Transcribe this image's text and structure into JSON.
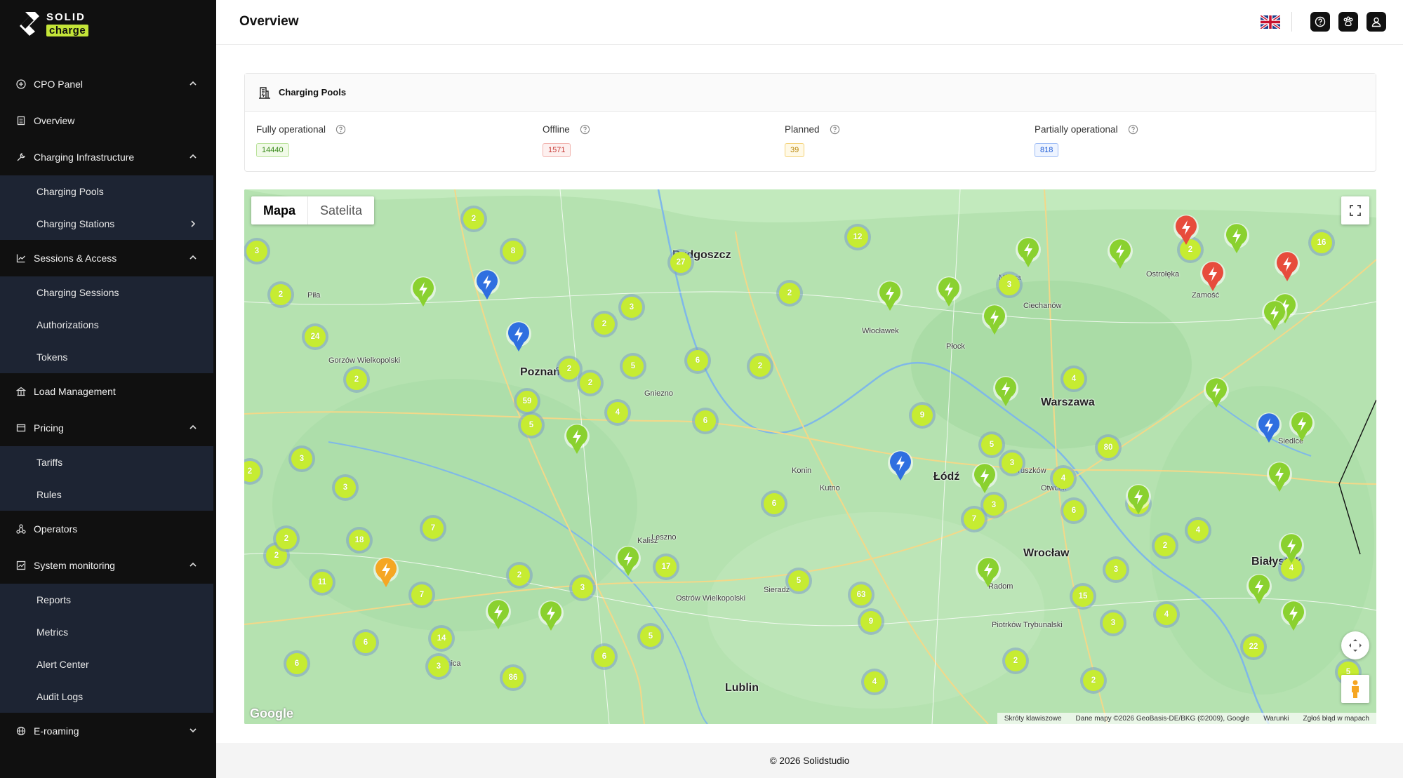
{
  "brand": {
    "line1": "SOLID",
    "line2": "charge"
  },
  "header": {
    "title": "Overview"
  },
  "nav": {
    "cpo_panel": "CPO Panel",
    "overview": "Overview",
    "charging_infrastructure": "Charging Infrastructure",
    "charging_pools": "Charging Pools",
    "charging_stations": "Charging Stations",
    "sessions_access": "Sessions & Access",
    "charging_sessions": "Charging Sessions",
    "authorizations": "Authorizations",
    "tokens": "Tokens",
    "load_management": "Load Management",
    "pricing": "Pricing",
    "tariffs": "Tariffs",
    "rules": "Rules",
    "operators": "Operators",
    "system_monitoring": "System monitoring",
    "reports": "Reports",
    "metrics": "Metrics",
    "alert_center": "Alert Center",
    "audit_logs": "Audit Logs",
    "e_roaming": "E-roaming"
  },
  "card": {
    "title": "Charging Pools",
    "stats": [
      {
        "label": "Fully operational",
        "value": "14440",
        "color": "#3a8a1c"
      },
      {
        "label": "Offline",
        "value": "1571",
        "color": "#c73a36"
      },
      {
        "label": "Planned",
        "value": "39",
        "color": "#b8860b"
      },
      {
        "label": "Partially operational",
        "value": "818",
        "color": "#1d5bd6"
      }
    ]
  },
  "map": {
    "type_map": "Mapa",
    "type_satellite": "Satelita",
    "google": "Google",
    "attribution": [
      "Skróty klawiszowe",
      "Dane mapy ©2026 GeoBasis-DE/BKG (©2009), Google",
      "Warunki",
      "Zgłoś błąd w mapach"
    ],
    "cities": [
      "Bydgoszcz",
      "Włocławek",
      "Płock",
      "Poznań",
      "Gniezno",
      "Warszawa",
      "Łódź",
      "Kalisz",
      "Wrocław",
      "Lublin",
      "Białystok",
      "Siedlce",
      "Radom",
      "Legnica",
      "Piotrków Trybunalski",
      "Ostrów Wielkopolski",
      "Gorzów Wielkopolski",
      "Pruszków",
      "Otwock",
      "Kutno",
      "Sieradz",
      "Mława",
      "Ciechanów",
      "Ostrołęka",
      "Zamość",
      "Piła",
      "Leszno",
      "Konin"
    ],
    "clusters": [
      "2",
      "8",
      "3",
      "2",
      "24",
      "2",
      "3",
      "2",
      "27",
      "3",
      "2",
      "6",
      "2",
      "12",
      "2",
      "6",
      "5",
      "2",
      "9",
      "3",
      "4",
      "80",
      "6",
      "5",
      "7",
      "3",
      "6",
      "59",
      "4",
      "5",
      "2",
      "3",
      "2",
      "18",
      "2",
      "11",
      "7",
      "7",
      "17",
      "3",
      "2",
      "5",
      "5",
      "63",
      "4",
      "3",
      "2",
      "15",
      "3",
      "4",
      "22",
      "5",
      "6",
      "14",
      "6",
      "3",
      "86",
      "6",
      "5",
      "9",
      "4",
      "2",
      "2",
      "4",
      "16",
      "3",
      "2",
      "4"
    ]
  },
  "footer": {
    "text": "© 2026 Solidstudio"
  }
}
